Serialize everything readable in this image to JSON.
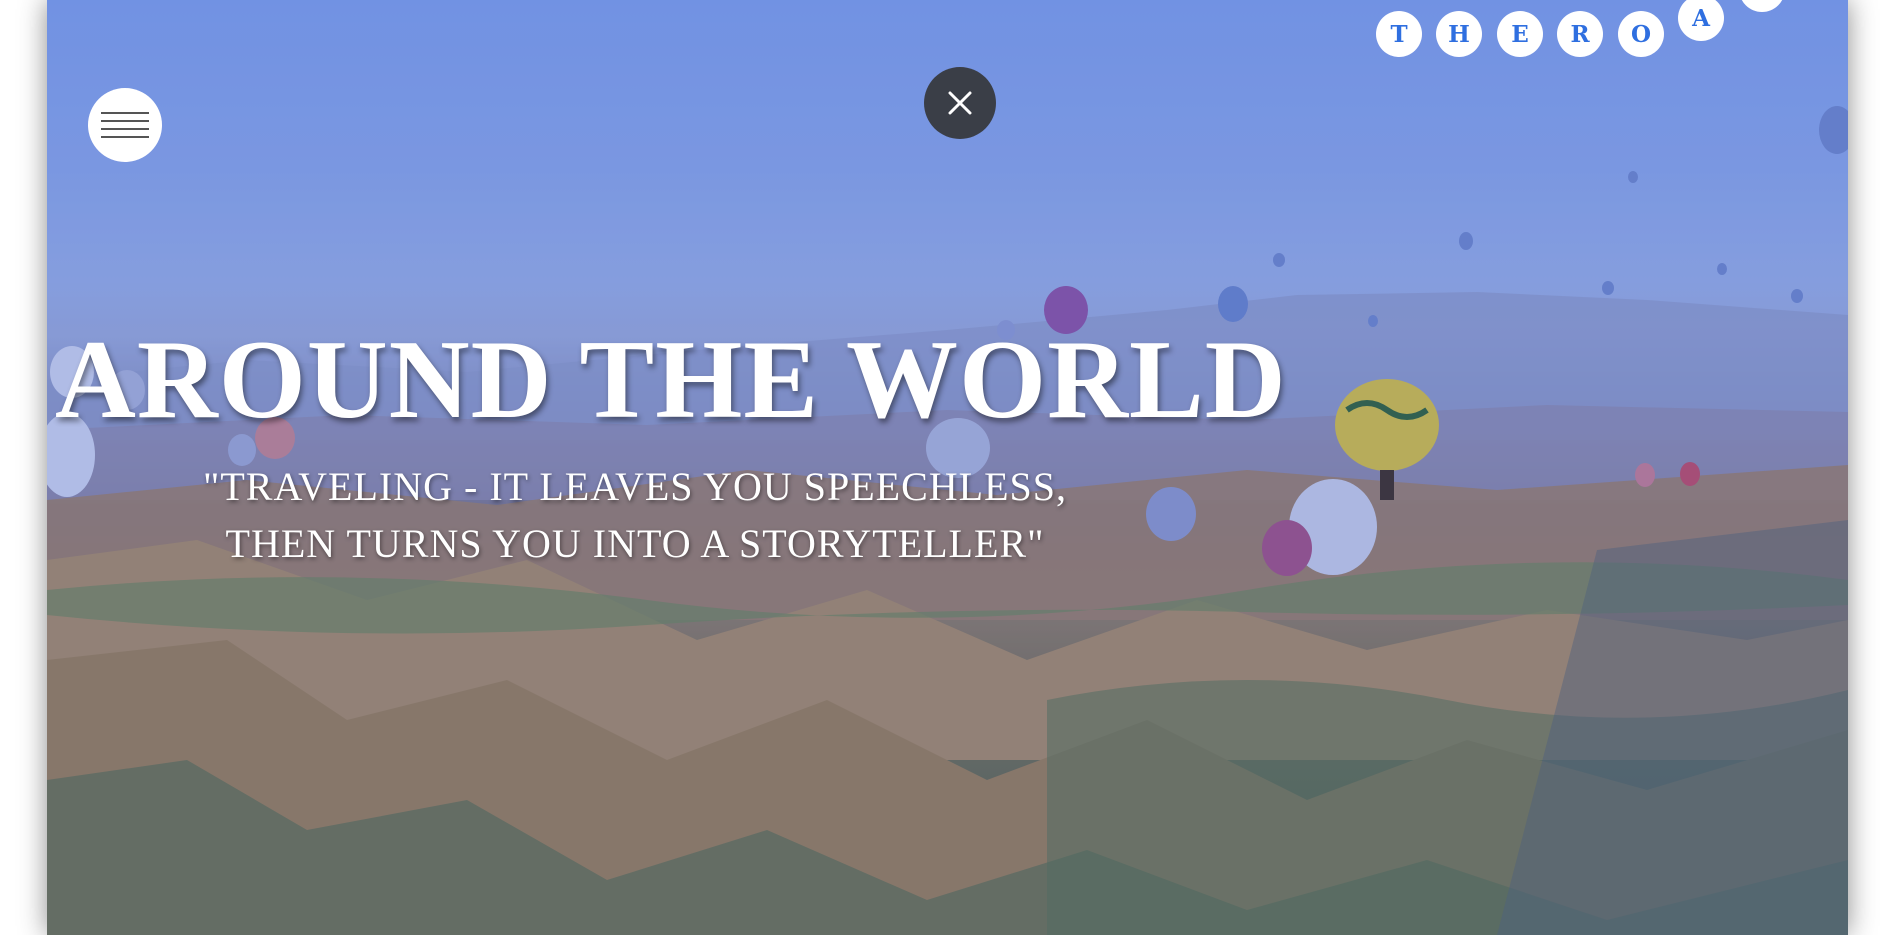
{
  "hero": {
    "title": "AROUND THE WORLD",
    "quote_line1": "\"TRAVELING - IT LEAVES YOU SPEECHLESS,",
    "quote_line2": "THEN TURNS YOU INTO A STORYTELLER\""
  },
  "logo": {
    "letters": [
      "T",
      "H",
      "E",
      "R",
      "O",
      "A"
    ]
  },
  "icons": {
    "menu": "hamburger-icon",
    "close": "close-icon"
  },
  "colors": {
    "accent": "#2f6fe0",
    "close_button": "#3a3e47",
    "sky": "#7e9fe8"
  }
}
